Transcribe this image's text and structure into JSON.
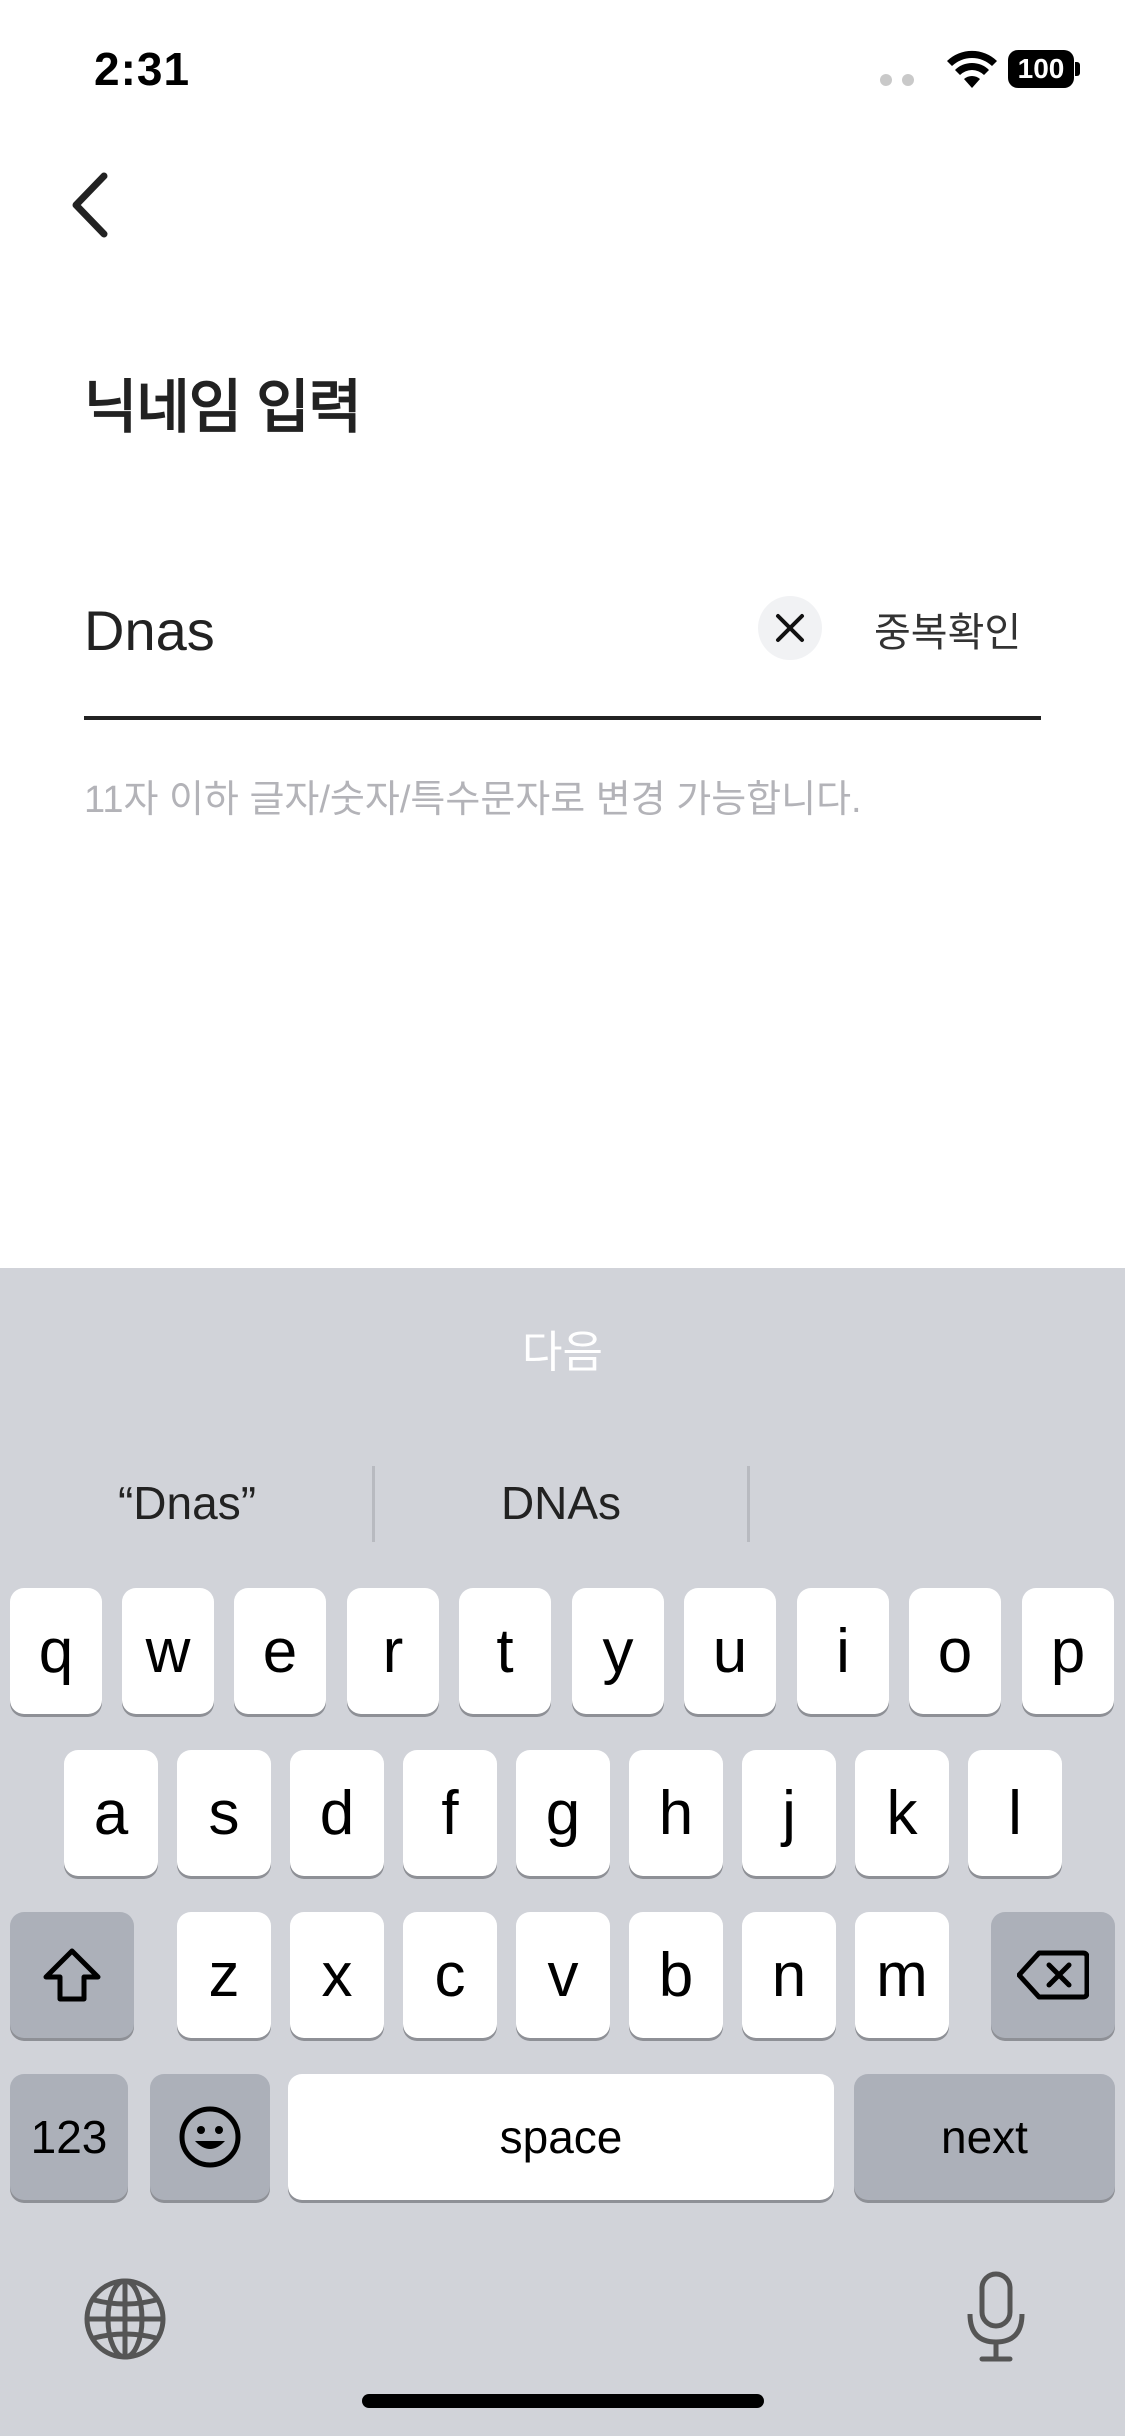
{
  "status_bar": {
    "time": "2:31",
    "battery": "100"
  },
  "header": {
    "title": "닉네임 입력"
  },
  "nickname": {
    "value": "Dnas",
    "dup_check_label": "중복확인",
    "helper_text": "11자 이하 글자/숫자/특수문자로 변경 가능합니다."
  },
  "keyboard": {
    "toolbar_next": "다음",
    "suggestions": [
      "“Dnas”",
      "DNAs"
    ],
    "row1": [
      "q",
      "w",
      "e",
      "r",
      "t",
      "y",
      "u",
      "i",
      "o",
      "p"
    ],
    "row2": [
      "a",
      "s",
      "d",
      "f",
      "g",
      "h",
      "j",
      "k",
      "l"
    ],
    "row3": [
      "z",
      "x",
      "c",
      "v",
      "b",
      "n",
      "m"
    ],
    "numbers_label": "123",
    "space_label": "space",
    "return_label": "next"
  },
  "colors": {
    "keyboard_bg": "#d1d3d9",
    "key_bg": "#ffffff",
    "dark_key_bg": "#acb0b9",
    "helper_text": "#b3b3b8"
  }
}
